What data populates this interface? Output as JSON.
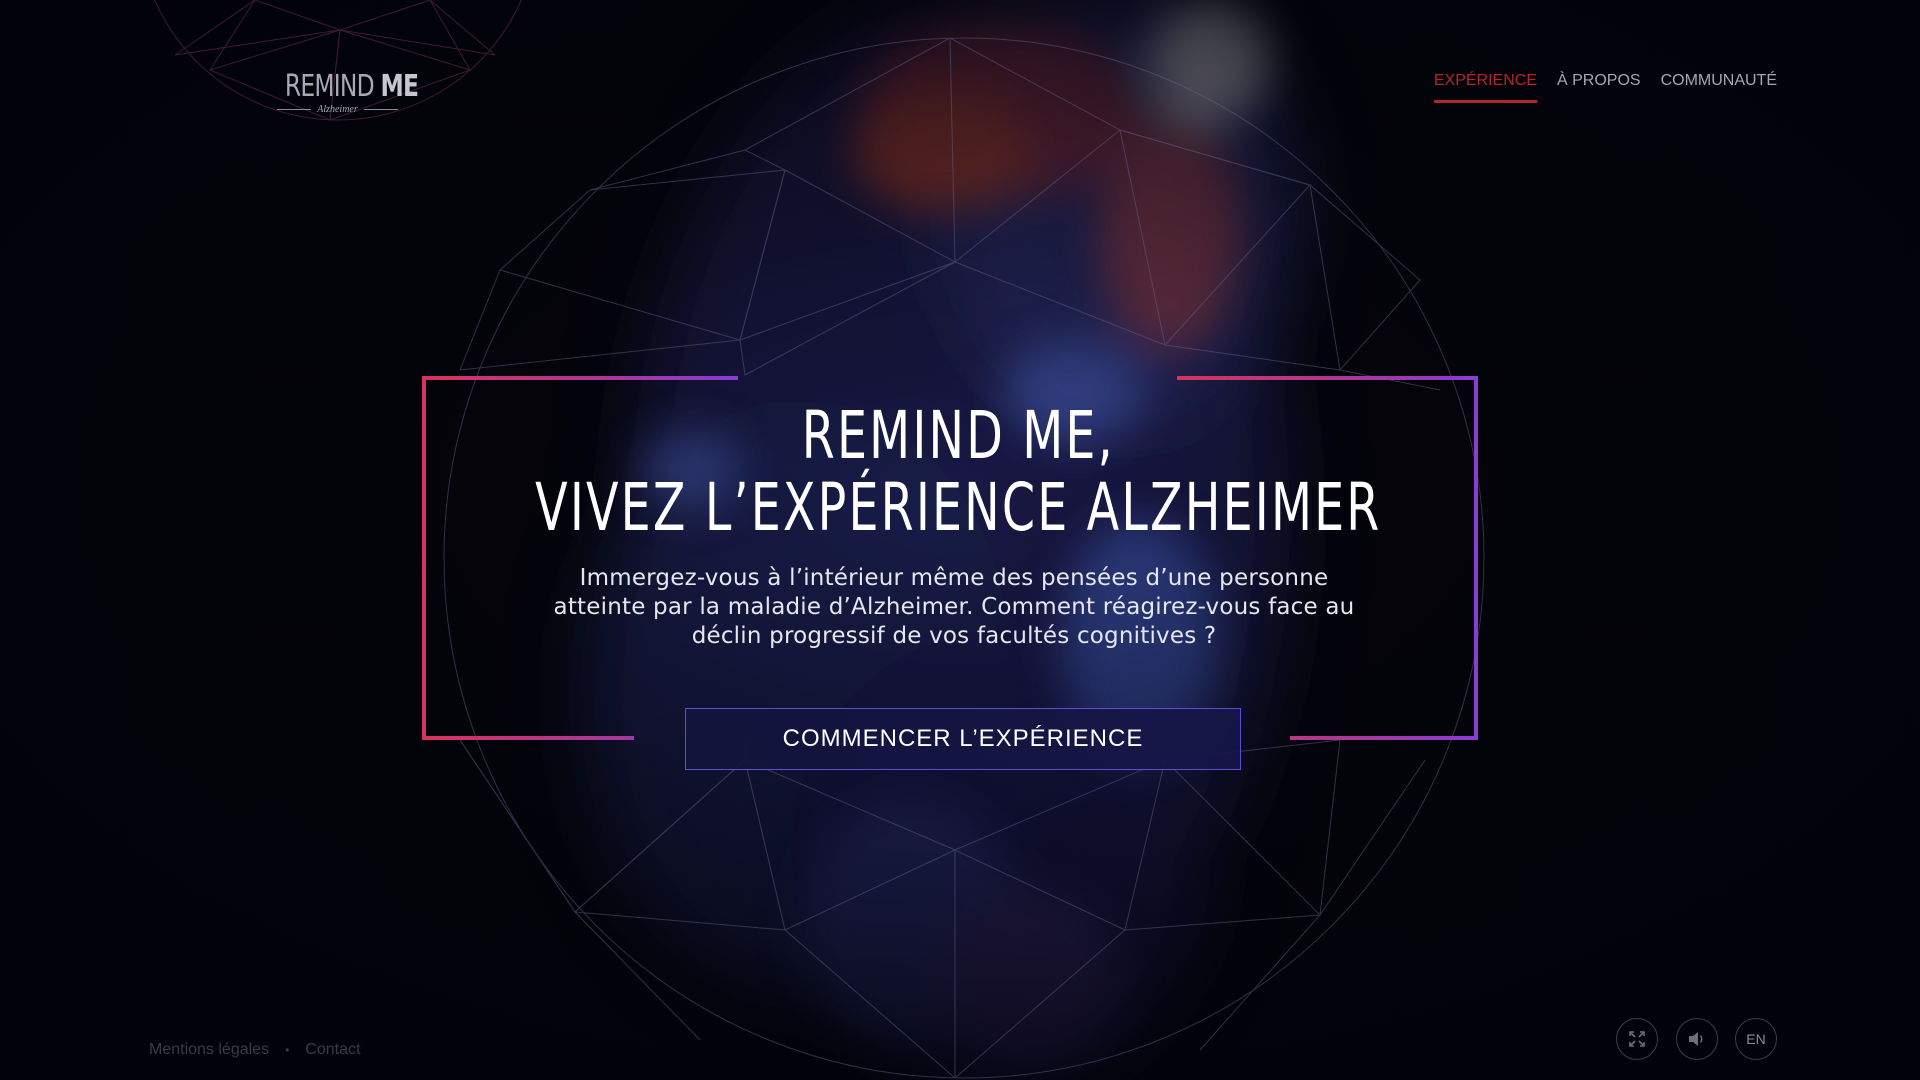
{
  "logo": {
    "title_light": "REMIND",
    "title_bold": "ME",
    "subtitle": "Alzheimer"
  },
  "nav": {
    "items": [
      {
        "label": "EXPÉRIENCE",
        "active": true
      },
      {
        "label": "À PROPOS",
        "active": false
      },
      {
        "label": "COMMUNAUTÉ",
        "active": false
      }
    ]
  },
  "hero": {
    "title_line1": "REMIND ME,",
    "title_line2": "VIVEZ L’EXPÉRIENCE ALZHEIMER",
    "description": "Immergez-vous à l’intérieur même des pensées d’une personne atteinte par la maladie d’Alzheimer. Comment réagirez-vous face au déclin progressif de vos facultés cognitives ?",
    "cta_label": "COMMENCER L’EXPÉRIENCE"
  },
  "footer": {
    "legal_label": "Mentions légales",
    "separator": "•",
    "contact_label": "Contact"
  },
  "controls": {
    "fullscreen_icon": "fullscreen-icon",
    "sound_icon": "speaker-icon",
    "language_label": "EN"
  },
  "colors": {
    "background": "#05050d",
    "accent_red": "#b4262f",
    "frame_left": "#d8335e",
    "frame_right": "#8a3bd8",
    "button_border": "#5b4fd6"
  }
}
